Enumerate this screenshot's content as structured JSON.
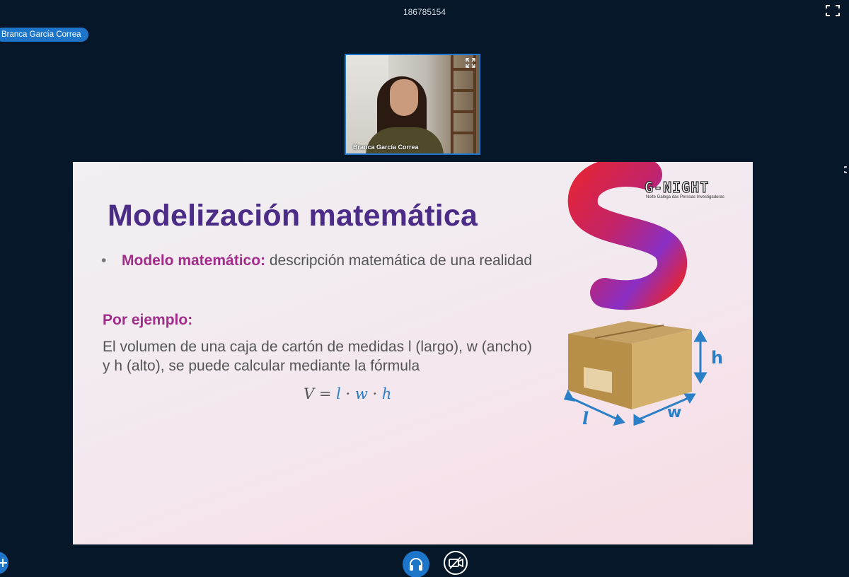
{
  "meeting": {
    "id": "186785154",
    "presenter_name": "Branca García Correa"
  },
  "video": {
    "participant_name": "Branca García Correa",
    "expand_icon": "expand-icon",
    "border_color": "#1f78d0"
  },
  "slide": {
    "title": "Modelización matemática",
    "bullet_term": "Modelo matemático:",
    "bullet_text": " descripción matemática de una realidad",
    "example_heading": "Por ejemplo:",
    "example_text": "El volumen de una caja de cartón de medidas l (largo), w (ancho) y h (alto), se puede calcular mediante la fórmula",
    "formula": {
      "lhs": "V",
      "eq": " = ",
      "v1": "l",
      "dot1": " · ",
      "v2": "w",
      "dot2": " · ",
      "v3": "h"
    },
    "logo_text": "G-NIGHT",
    "logo_subtitle": "Noite Galega das Persoas Investigadoras",
    "box_labels": {
      "length": "l",
      "width": "w",
      "height": "h"
    },
    "colors": {
      "title": "#4b2c87",
      "accent": "#a32b8a",
      "arrow": "#2a7fc7"
    }
  },
  "controls": {
    "audio_icon": "headphones-icon",
    "video_icon": "camera-off-icon",
    "accent": "#1d75c9"
  }
}
